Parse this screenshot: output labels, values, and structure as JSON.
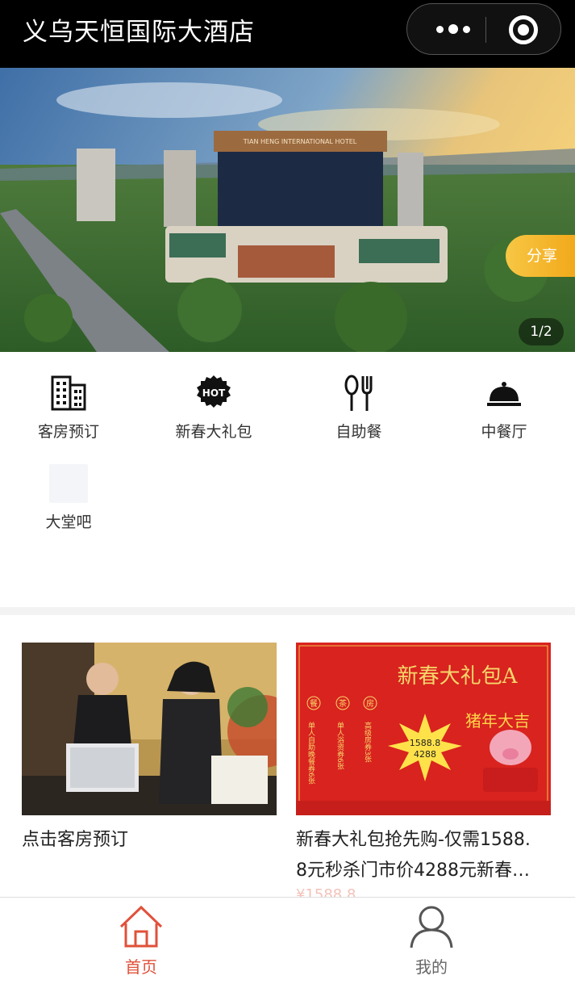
{
  "app": {
    "title": "义乌天恒国际大酒店"
  },
  "capsule": {
    "more_icon": "more-dots-icon",
    "close_icon": "target-close-icon"
  },
  "banner": {
    "hotel_sign": "TIAN HENG INTERNATIONAL HOTEL",
    "share_label": "分享",
    "pager": "1/2"
  },
  "menu": {
    "items": [
      {
        "label": "客房预订",
        "icon": "building-icon"
      },
      {
        "label": "新春大礼包",
        "icon": "hot-badge-icon"
      },
      {
        "label": "自助餐",
        "icon": "spoon-fork-icon"
      },
      {
        "label": "中餐厅",
        "icon": "food-cloche-icon"
      },
      {
        "label": "大堂吧",
        "icon": "image-placeholder-icon"
      }
    ]
  },
  "cards": [
    {
      "title": "点击客房预订",
      "image": "reception-desk-photo"
    },
    {
      "title": "新春大礼包抢先购-仅需1588.8元秒杀门市价4288元新春…",
      "title_line1": "新春大礼包抢先购-仅需1588.",
      "title_line2": "8元秒杀门市价4288元新春…",
      "price": "¥1588.8",
      "image": "gift-package-poster",
      "poster": {
        "headline": "新春大礼包A",
        "columns": [
          {
            "badge": "餐",
            "text": "单人自助晚餐券6张"
          },
          {
            "badge": "茶",
            "text": "单人浴资券6张"
          },
          {
            "badge": "房",
            "text": "高级房券3张"
          }
        ],
        "burst_price": "1588.8",
        "burst_orig": "4288",
        "script": "猪年大吉"
      }
    }
  ],
  "tabbar": {
    "tabs": [
      {
        "label": "首页",
        "icon": "home-icon",
        "active": true
      },
      {
        "label": "我的",
        "icon": "user-icon",
        "active": false
      }
    ]
  },
  "colors": {
    "accent": "#e0513a",
    "share": "#f2a91b",
    "header_bg": "#000000"
  }
}
